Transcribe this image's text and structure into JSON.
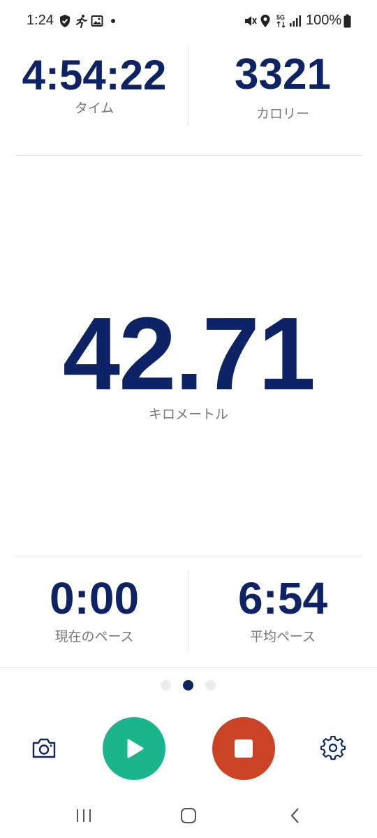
{
  "status_bar": {
    "time": "1:24",
    "battery": "100%",
    "icons": [
      "shield-check-icon",
      "running-icon",
      "image-icon",
      "dot-icon",
      "mute-icon",
      "location-icon",
      "5g-icon",
      "signal-icon",
      "battery-icon"
    ]
  },
  "stats": {
    "time": {
      "value": "4:54:22",
      "label": "タイム"
    },
    "calories": {
      "value": "3321",
      "label": "カロリー"
    },
    "distance": {
      "value": "42.71",
      "label": "キロメートル"
    },
    "current_pace": {
      "value": "0:00",
      "label": "現在のペース"
    },
    "average_pace": {
      "value": "6:54",
      "label": "平均ペース"
    }
  },
  "pager": {
    "count": 3,
    "active_index": 1
  },
  "controls": [
    "camera-icon",
    "play-button",
    "stop-button",
    "settings-icon"
  ],
  "colors": {
    "primary": "#0d2366",
    "play": "#1ab58c",
    "stop": "#c94324"
  },
  "nav_bar": [
    "recent-apps-button",
    "home-button",
    "back-button"
  ]
}
